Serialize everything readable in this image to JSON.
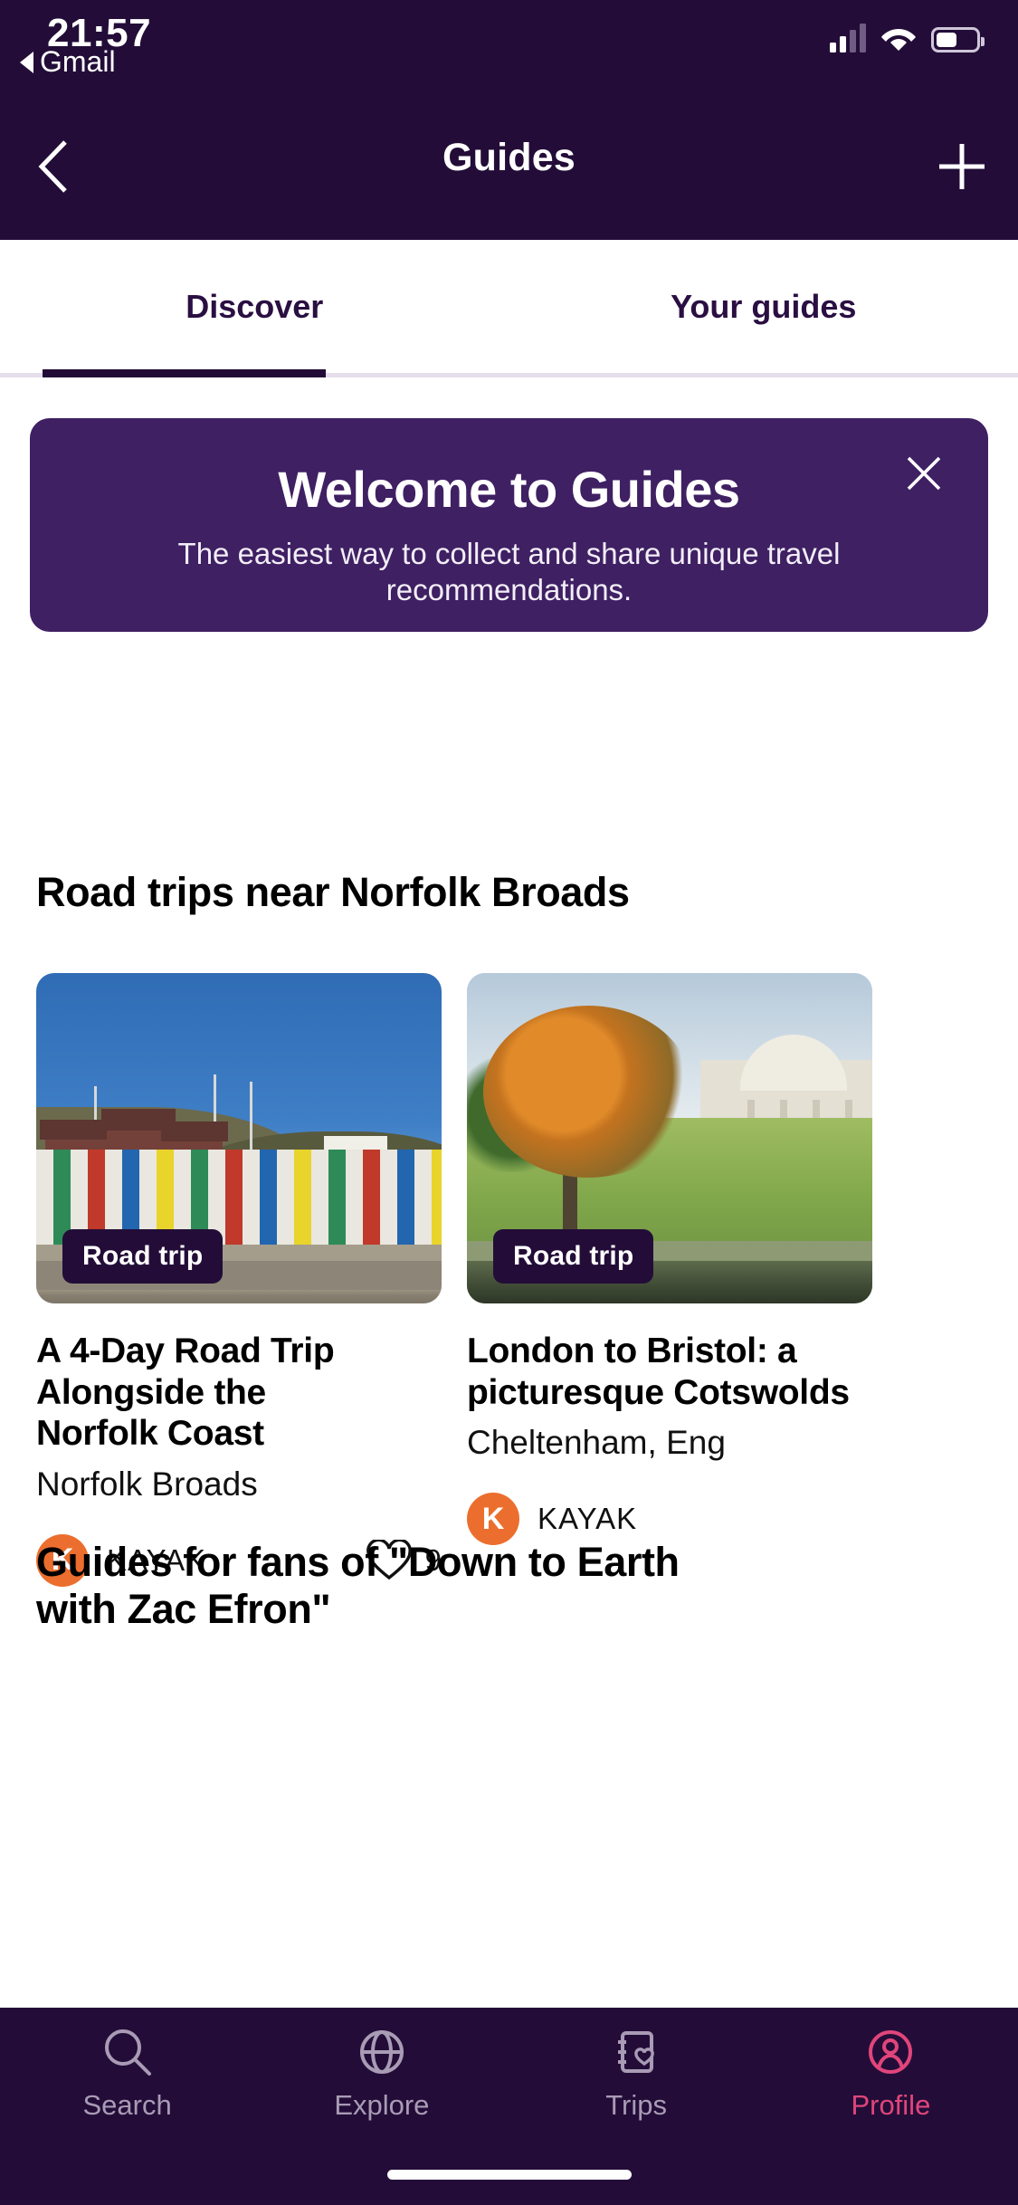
{
  "status_bar": {
    "time": "21:57",
    "back_app_label": "Gmail",
    "back_arrow_icon": "triangle-left-icon",
    "signal_icon": "cellular-signal-icon",
    "wifi_icon": "wifi-icon",
    "battery_icon": "battery-icon"
  },
  "header": {
    "title": "Guides",
    "back_icon": "chevron-left-icon",
    "add_icon": "plus-icon"
  },
  "tabs": {
    "items": [
      {
        "label": "Discover",
        "active": true
      },
      {
        "label": "Your guides",
        "active": false
      }
    ]
  },
  "welcome_banner": {
    "title": "Welcome to Guides",
    "subtitle": "The easiest way to collect and share unique travel recommendations.",
    "close_icon": "close-icon",
    "background_color": "#3f2063"
  },
  "sections": [
    {
      "title": "Road trips near Norfolk Broads",
      "cards": [
        {
          "badge": "Road trip",
          "title": "A 4-Day Road Trip Alongside the\nNorfolk Coast",
          "location": "Norfolk Broads",
          "author_initial": "K",
          "author": "KAYAK",
          "likes": "9",
          "like_icon": "heart-outline-icon",
          "image_alt": "colorful beach huts along the Norfolk coast under a blue sky"
        },
        {
          "badge": "Road trip",
          "title": "London to Bristol: a\npicturesque Cotswolds",
          "location": "Cheltenham, Eng",
          "author_initial": "K",
          "author": "KAYAK",
          "likes": "",
          "like_icon": "heart-outline-icon",
          "image_alt": "autumn tree and lawn beside a lake with a white mansion"
        }
      ]
    },
    {
      "title": "Guides for fans of \"Down to Earth\nwith Zac Efron\""
    }
  ],
  "bottom_nav": {
    "items": [
      {
        "label": "Search",
        "icon": "magnifier-icon",
        "active": false
      },
      {
        "label": "Explore",
        "icon": "globe-icon",
        "active": false
      },
      {
        "label": "Trips",
        "icon": "trips-heart-icon",
        "active": false
      },
      {
        "label": "Profile",
        "icon": "person-circle-icon",
        "active": true
      }
    ],
    "active_color": "#e0457b",
    "background_color": "#230d38"
  }
}
